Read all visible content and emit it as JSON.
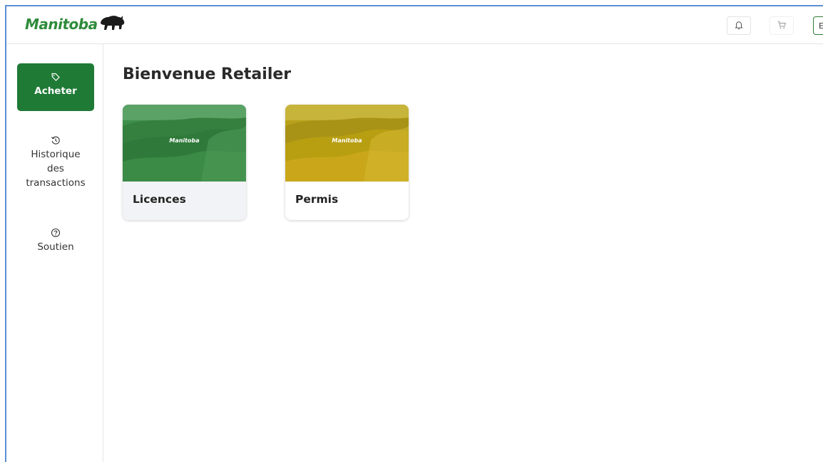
{
  "header": {
    "logo_text": "Manitoba",
    "user_initial": "E"
  },
  "sidebar": {
    "items": [
      {
        "label": "Acheter",
        "icon": "tag-icon",
        "active": true
      },
      {
        "label_lines": [
          "Historique",
          "des",
          "transactions"
        ],
        "icon": "history-icon",
        "active": false
      },
      {
        "label": "Soutien",
        "icon": "help-icon",
        "active": false
      }
    ]
  },
  "main": {
    "title": "Bienvenue Retailer",
    "cards": [
      {
        "label": "Licences",
        "image_logo": "Manitoba",
        "tint": "#2e8b3a"
      },
      {
        "label": "Permis",
        "image_logo": "Manitoba",
        "tint": "#c9a500"
      }
    ]
  },
  "colors": {
    "brand_green": "#1f7a35",
    "logo_green": "#2e8b3a"
  }
}
